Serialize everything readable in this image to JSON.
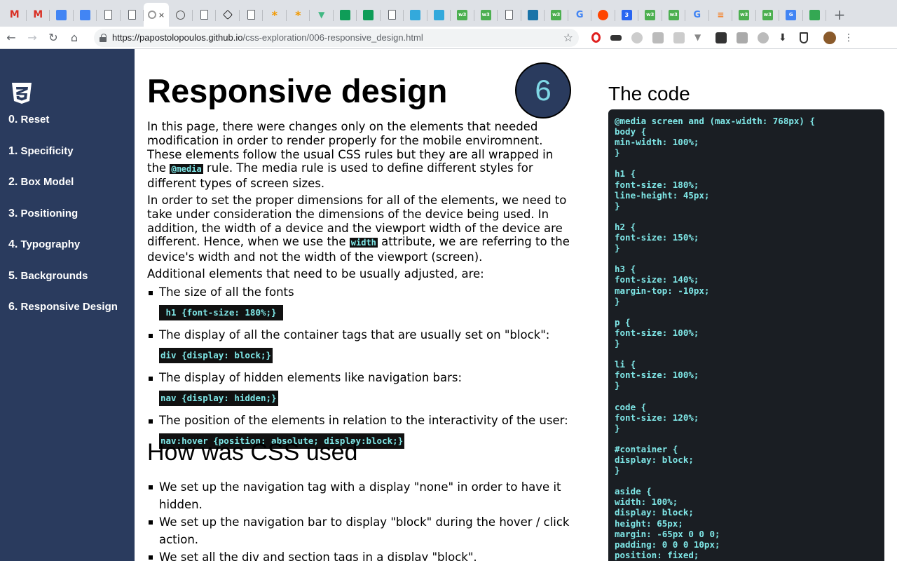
{
  "browser": {
    "active_tab_close": "×",
    "new_tab": "+",
    "url_host": "https://papostolopoulos.github.io",
    "url_path": "/css-exploration/006-responsive_design.html"
  },
  "sidebar": {
    "logo_label": "3",
    "items": [
      {
        "num": "0.",
        "label": "Reset"
      },
      {
        "num": "1.",
        "label": "Specificity"
      },
      {
        "num": "2.",
        "label": "Box Model"
      },
      {
        "num": "3.",
        "label": "Positioning"
      },
      {
        "num": "4.",
        "label": "Typography"
      },
      {
        "num": "5.",
        "label": "Backgrounds"
      },
      {
        "num": "6.",
        "label": "Responsive Design"
      }
    ]
  },
  "main": {
    "title": "Responsive design",
    "badge": "6",
    "p1_a": "In this page, there were changes only on the elements that needed modification in order to render properly for the mobile enviromnent. These elements follow the usual CSS rules but they are all wrapped in the ",
    "p1_code": "@media",
    "p1_b": " rule. The media rule is used to define different styles for different types of screen sizes.",
    "p2_a": "In order to set the proper dimensions for all of the elements, we need to take under consideration the dimensions of the device being used. In addition, the width of a device and the viewport width of the device are different. Hence, when we use the ",
    "p2_code": "width",
    "p2_b": " attribute, we are referring to the device's width and not the width of the viewport (screen).",
    "p3": "Additional elements that need to be usually adjusted, are:",
    "list": [
      {
        "text": "The size of all the fonts",
        "code": " h1 {font-size: 180%;} "
      },
      {
        "text": "The display of all the container tags that are usually set on \"block\":",
        "code": "div {display: block;}"
      },
      {
        "text": "The display of hidden elements like navigation bars:",
        "code": "nav {display: hidden;}"
      },
      {
        "text": "The position of the elements in relation to the interactivity of the user:",
        "code": "nav:hover {position: absolute; display:block;}"
      }
    ],
    "h2": "How was CSS used",
    "list2": [
      "We set up the navigation tag with a display \"none\" in order to have it hidden.",
      "We set up the navigation bar to display \"block\" during the hover / click action.",
      "We set all the div and section tags in a display \"block\"."
    ]
  },
  "code_panel": {
    "title": "The code",
    "code": "@media screen and (max-width: 768px) {\nbody {\nmin-width: 100%;\n}\n\nh1 {\nfont-size: 180%;\nline-height: 45px;\n}\n\nh2 {\nfont-size: 150%;\n}\n\nh3 {\nfont-size: 140%;\nmargin-top: -10px;\n}\n\np {\nfont-size: 100%;\n}\n\nli {\nfont-size: 100%;\n}\n\ncode {\nfont-size: 120%;\n}\n\n#container {\ndisplay: block;\n}\n\naside {\nwidth: 100%;\ndisplay: block;\nheight: 65px;\nmargin: -65px 0 0 0;\npadding: 0 0 0 10px;\nposition: fixed;"
  }
}
